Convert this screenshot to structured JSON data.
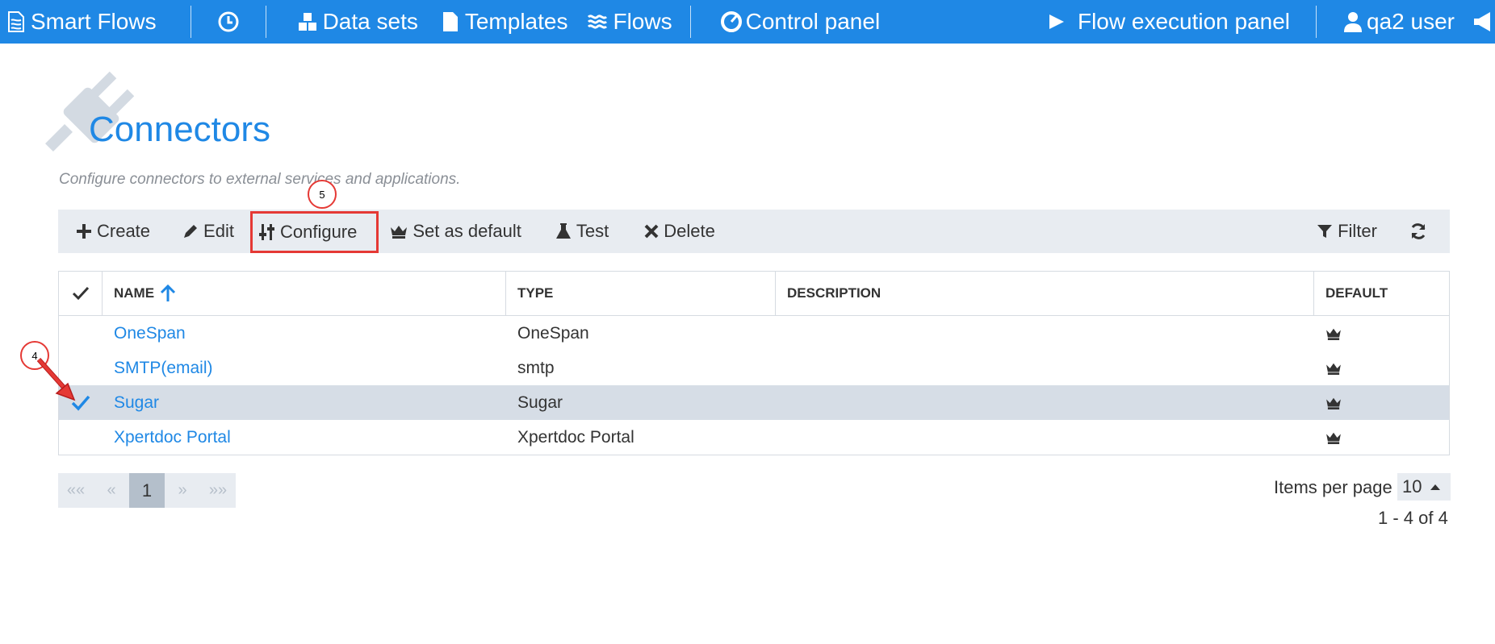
{
  "topbar": {
    "brand": "Smart Flows",
    "datasets": "Data sets",
    "templates": "Templates",
    "flows": "Flows",
    "control_panel": "Control panel",
    "flow_execution_panel": "Flow execution panel",
    "user": "qa2 user"
  },
  "page": {
    "title": "Connectors",
    "subtitle": "Configure connectors to external services and applications."
  },
  "toolbar": {
    "create": "Create",
    "edit": "Edit",
    "configure": "Configure",
    "set_default": "Set as default",
    "test": "Test",
    "delete": "Delete",
    "filter": "Filter"
  },
  "annotations": {
    "step_configure": "5",
    "step_select": "4"
  },
  "table": {
    "headers": {
      "name": "NAME",
      "type": "TYPE",
      "description": "DESCRIPTION",
      "default": "DEFAULT"
    },
    "rows": [
      {
        "name": "OneSpan",
        "type": "OneSpan",
        "description": "",
        "selected": false
      },
      {
        "name": "SMTP(email)",
        "type": "smtp",
        "description": "",
        "selected": false
      },
      {
        "name": "Sugar",
        "type": "Sugar",
        "description": "",
        "selected": true
      },
      {
        "name": "Xpertdoc Portal",
        "type": "Xpertdoc Portal",
        "description": "",
        "selected": false
      }
    ]
  },
  "pager": {
    "first": "««",
    "prev": "«",
    "current": "1",
    "next": "»",
    "last": "»»",
    "items_per_page_label": "Items per page",
    "items_per_page": "10",
    "range": "1 - 4 of 4"
  },
  "colors": {
    "accent": "#1f88e5",
    "toolbar_bg": "#e8ecf1",
    "selected_row": "#d6dde6",
    "annotation": "#e53935"
  }
}
